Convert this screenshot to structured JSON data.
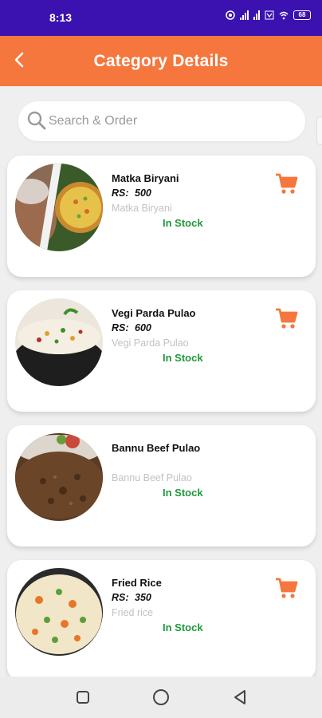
{
  "status_bar": {
    "time": "8:13",
    "icons": [
      "location-icon",
      "signal-icon",
      "signal-icon",
      "volte-icon",
      "wifi-icon",
      "battery-icon"
    ],
    "battery_level": "68"
  },
  "app_bar": {
    "title": "Category Details",
    "back_icon": "chevron-left-icon",
    "background": "#f5773d"
  },
  "search": {
    "placeholder": "Search & Order",
    "value": ""
  },
  "items": [
    {
      "name": "Matka Biryani",
      "price_label": "RS:",
      "price": "500",
      "description": "Matka Biryani",
      "stock": "In Stock",
      "has_cart": true
    },
    {
      "name": "Vegi Parda Pulao",
      "price_label": "RS:",
      "price": "600",
      "description": "Vegi Parda Pulao",
      "stock": "In Stock",
      "has_cart": true
    },
    {
      "name": "Bannu Beef Pulao",
      "price_label": "",
      "price": "",
      "description": "Bannu Beef Pulao",
      "stock": "In Stock",
      "has_cart": false
    },
    {
      "name": "Fried Rice",
      "price_label": "RS:",
      "price": "350",
      "description": "Fried rice",
      "stock": "In Stock",
      "has_cart": true
    }
  ],
  "colors": {
    "accent": "#f5773d",
    "status_bar": "#3b12b0",
    "in_stock": "#1e9a3a"
  },
  "nav_bar": {
    "buttons": [
      "recents-square-icon",
      "home-circle-icon",
      "back-triangle-icon"
    ]
  }
}
